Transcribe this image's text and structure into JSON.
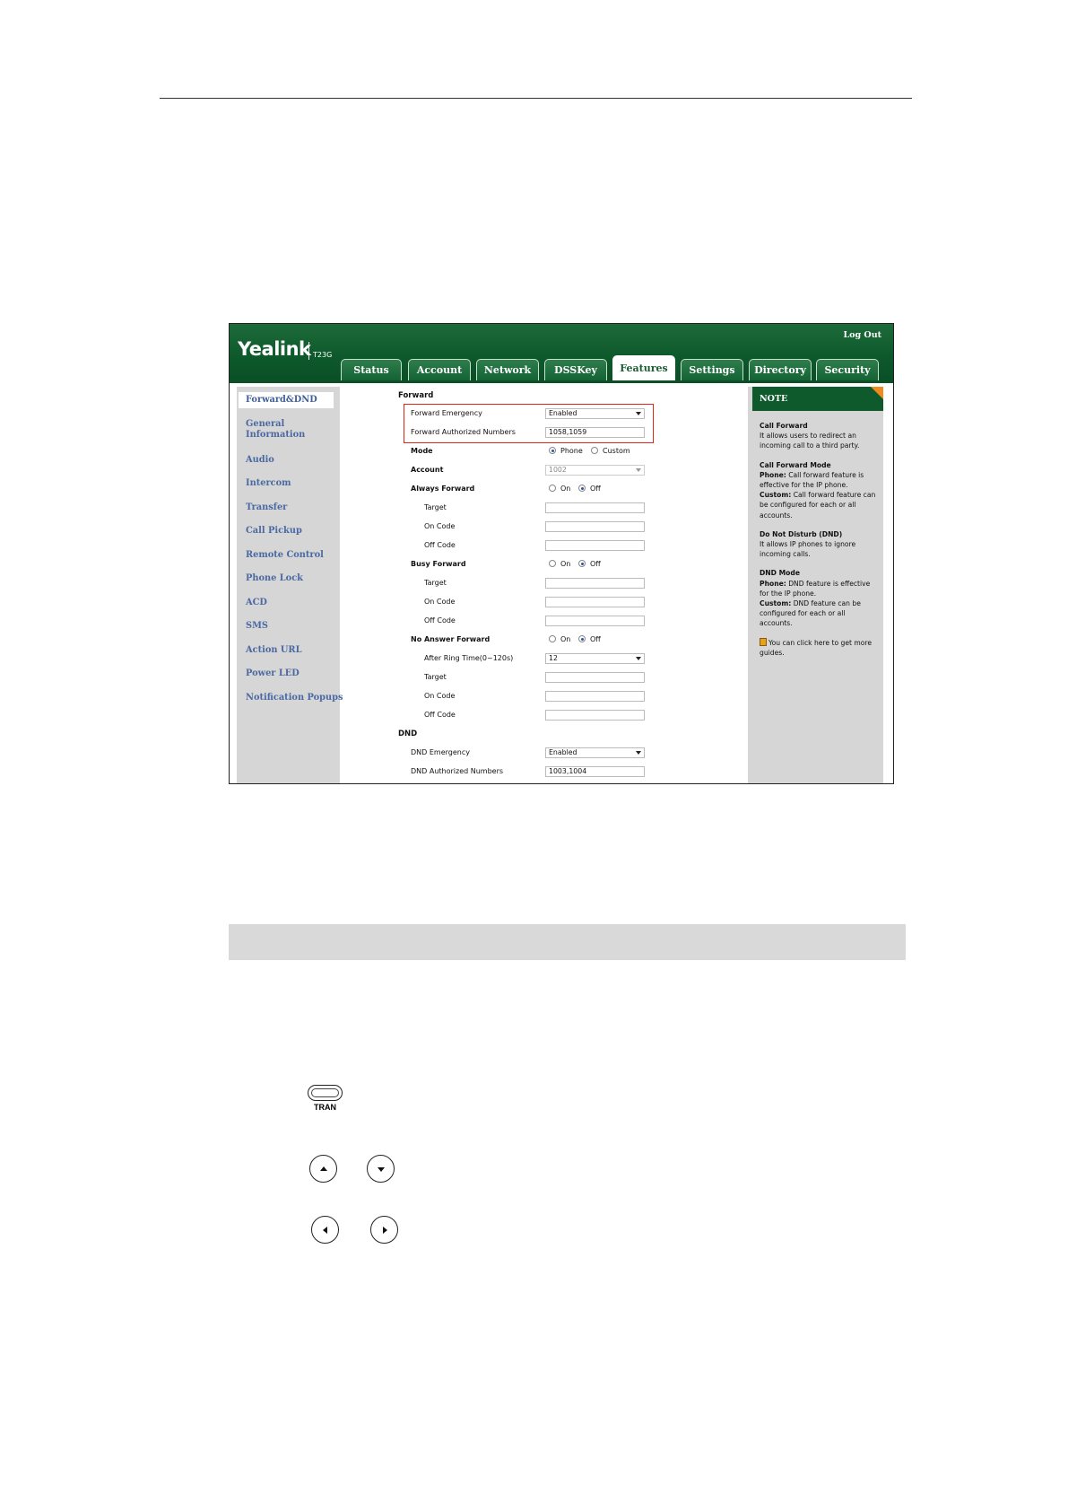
{
  "app": {
    "logo": "Yealink",
    "model": "T23G",
    "logout": "Log Out"
  },
  "tabs": [
    {
      "label": "Status",
      "active": false
    },
    {
      "label": "Account",
      "active": false
    },
    {
      "label": "Network",
      "active": false
    },
    {
      "label": "DSSKey",
      "active": false
    },
    {
      "label": "Features",
      "active": true
    },
    {
      "label": "Settings",
      "active": false
    },
    {
      "label": "Directory",
      "active": false
    },
    {
      "label": "Security",
      "active": false
    }
  ],
  "sidebar": {
    "items": [
      "Forward&DND",
      "General Information",
      "Audio",
      "Intercom",
      "Transfer",
      "Call Pickup",
      "Remote Control",
      "Phone Lock",
      "ACD",
      "SMS",
      "Action URL",
      "Power LED",
      "Notification Popups"
    ],
    "general_line1": "General",
    "general_line2": "Information"
  },
  "forward": {
    "section": "Forward",
    "emergency_label": "Forward Emergency",
    "emergency_value": "Enabled",
    "authorized_label": "Forward Authorized Numbers",
    "authorized_value": "1058,1059",
    "mode_label": "Mode",
    "mode_phone": "Phone",
    "mode_custom": "Custom",
    "mode_selected": "Phone",
    "account_label": "Account",
    "account_value": "1002",
    "always_label": "Always Forward",
    "busy_label": "Busy Forward",
    "noanswer_label": "No Answer Forward",
    "on": "On",
    "off": "Off",
    "target": "Target",
    "on_code": "On Code",
    "off_code": "Off Code",
    "ring_time_label": "After Ring Time(0~120s)",
    "ring_time_value": "12"
  },
  "dnd": {
    "section": "DND",
    "emergency_label": "DND Emergency",
    "emergency_value": "Enabled",
    "authorized_label": "DND Authorized Numbers",
    "authorized_value": "1003,1004"
  },
  "note": {
    "title": "NOTE",
    "cf_title": "Call Forward",
    "cf_text": "It allows users to redirect an incoming call to a third party.",
    "cfm_title": "Call Forward Mode",
    "cfm_phone_b": "Phone:",
    "cfm_phone": " Call forward feature is effective for the IP phone.",
    "cfm_custom_b": "Custom:",
    "cfm_custom": " Call forward feature can be configured for each or all accounts.",
    "dnd_title": "Do Not Disturb (DND)",
    "dnd_text": "It allows IP phones to ignore incoming calls.",
    "dndm_title": "DND Mode",
    "dndm_phone_b": "Phone:",
    "dndm_phone": " DND feature is effective for the IP phone.",
    "dndm_custom_b": "Custom:",
    "dndm_custom": " DND feature can be configured for each or all accounts.",
    "guide": "You can click here to get more guides."
  },
  "keys": {
    "tran_label": "TRAN"
  }
}
